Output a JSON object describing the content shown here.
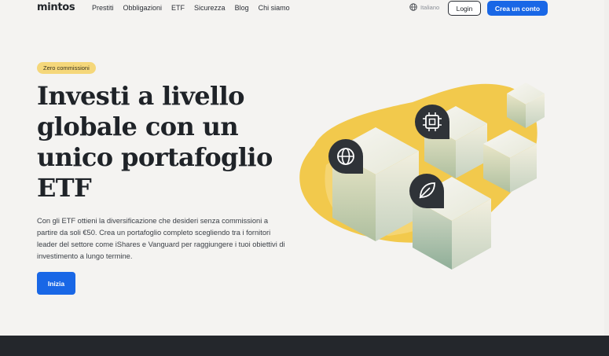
{
  "nav": {
    "logo": "mintos",
    "items": [
      "Prestiti",
      "Obbligazioni",
      "ETF",
      "Sicurezza",
      "Blog",
      "Chi siamo"
    ],
    "language": "Italiano",
    "login": "Login",
    "signup": "Crea un conto"
  },
  "hero": {
    "badge": "Zero commissioni",
    "headline_lines": [
      "Investi a livello",
      "globale con un",
      "unico portafoglio",
      "ETF"
    ],
    "description": "Con gli ETF ottieni la diversificazione che desideri senza commissioni a partire da soli €50. Crea un portafoglio completo scegliendo tra i fornitori leader del settore come iShares e Vanguard per raggiungere i tuoi obiettivi di investimento a lungo termine.",
    "cta": "Inizia"
  },
  "colors": {
    "accent": "#1967e6",
    "badge": "#f5d77a",
    "blob": "#f2c94c",
    "footer": "#24272c"
  },
  "illustration_icons": [
    "globe-icon",
    "chip-icon",
    "leaf-icon"
  ]
}
